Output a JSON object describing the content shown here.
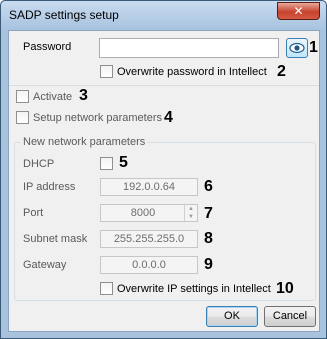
{
  "window": {
    "title": "SADP settings setup",
    "close_glyph": "✕"
  },
  "password": {
    "label": "Password",
    "value": "",
    "overwrite_label": "Overwrite password in Intellect",
    "show_icon": "eye-icon"
  },
  "activate_label": "Activate",
  "setup_network_label": "Setup network parameters",
  "network_group": {
    "title": "New network parameters",
    "dhcp_label": "DHCP",
    "ip_label": "IP address",
    "ip_value": "192.0.0.64",
    "port_label": "Port",
    "port_value": "8000",
    "subnet_label": "Subnet mask",
    "subnet_value": "255.255.255.0",
    "gateway_label": "Gateway",
    "gateway_value": "0.0.0.0",
    "overwrite_ip_label": "Overwrite IP settings in Intellect"
  },
  "buttons": {
    "ok": "OK",
    "cancel": "Cancel"
  },
  "annotations": [
    "1",
    "2",
    "3",
    "4",
    "5",
    "6",
    "7",
    "8",
    "9",
    "10"
  ]
}
